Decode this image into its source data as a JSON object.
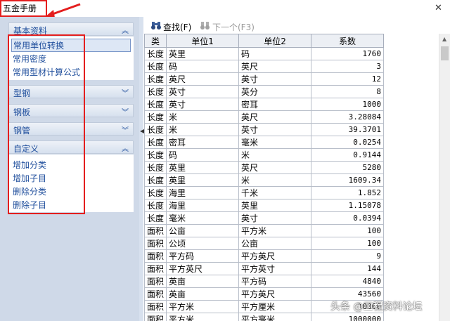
{
  "window": {
    "title": "五金手册",
    "close_glyph": "✕"
  },
  "sidebar": {
    "categories": [
      {
        "label": "基本资料",
        "chevron": "︽",
        "items": [
          "常用单位转换",
          "常用密度",
          "常用型材计算公式"
        ]
      },
      {
        "label": "型钢",
        "chevron": "︾"
      },
      {
        "label": "钢板",
        "chevron": "︾"
      },
      {
        "label": "钢管",
        "chevron": "︾"
      },
      {
        "label": "自定义",
        "chevron": "︽",
        "items": [
          "增加分类",
          "增加子目",
          "删除分类",
          "删除子目"
        ]
      }
    ]
  },
  "toolbar": {
    "find_label": "查找(F)",
    "next_label": "下一个(F3)"
  },
  "table": {
    "headers": [
      "类",
      "单位1",
      "单位2",
      "系数"
    ],
    "rows": [
      [
        "长度",
        "英里",
        "码",
        "1760"
      ],
      [
        "长度",
        "码",
        "英尺",
        "3"
      ],
      [
        "长度",
        "英尺",
        "英寸",
        "12"
      ],
      [
        "长度",
        "英寸",
        "英分",
        "8"
      ],
      [
        "长度",
        "英寸",
        "密耳",
        "1000"
      ],
      [
        "长度",
        "米",
        "英尺",
        "3.28084"
      ],
      [
        "长度",
        "米",
        "英寸",
        "39.3701"
      ],
      [
        "长度",
        "密耳",
        "毫米",
        "0.0254"
      ],
      [
        "长度",
        "码",
        "米",
        "0.9144"
      ],
      [
        "长度",
        "英里",
        "英尺",
        "5280"
      ],
      [
        "长度",
        "英里",
        "米",
        "1609.34"
      ],
      [
        "长度",
        "海里",
        "千米",
        "1.852"
      ],
      [
        "长度",
        "海里",
        "英里",
        "1.15078"
      ],
      [
        "长度",
        "毫米",
        "英寸",
        "0.0394"
      ],
      [
        "面积",
        "公亩",
        "平方米",
        "100"
      ],
      [
        "面积",
        "公顷",
        "公亩",
        "100"
      ],
      [
        "面积",
        "平方码",
        "平方英尺",
        "9"
      ],
      [
        "面积",
        "平方英尺",
        "平方英寸",
        "144"
      ],
      [
        "面积",
        "英亩",
        "平方码",
        "4840"
      ],
      [
        "面积",
        "英亩",
        "平方英尺",
        "43560"
      ],
      [
        "面积",
        "平方米",
        "平方厘米",
        "10000"
      ],
      [
        "面积",
        "平方米",
        "平方毫米",
        "1000000"
      ]
    ]
  },
  "watermark": "头条 @工程资料论坛",
  "colors": {
    "highlight_border": "#e41e1e",
    "link_text": "#1f4e9c",
    "panel_bg": "#cfd9e8"
  }
}
